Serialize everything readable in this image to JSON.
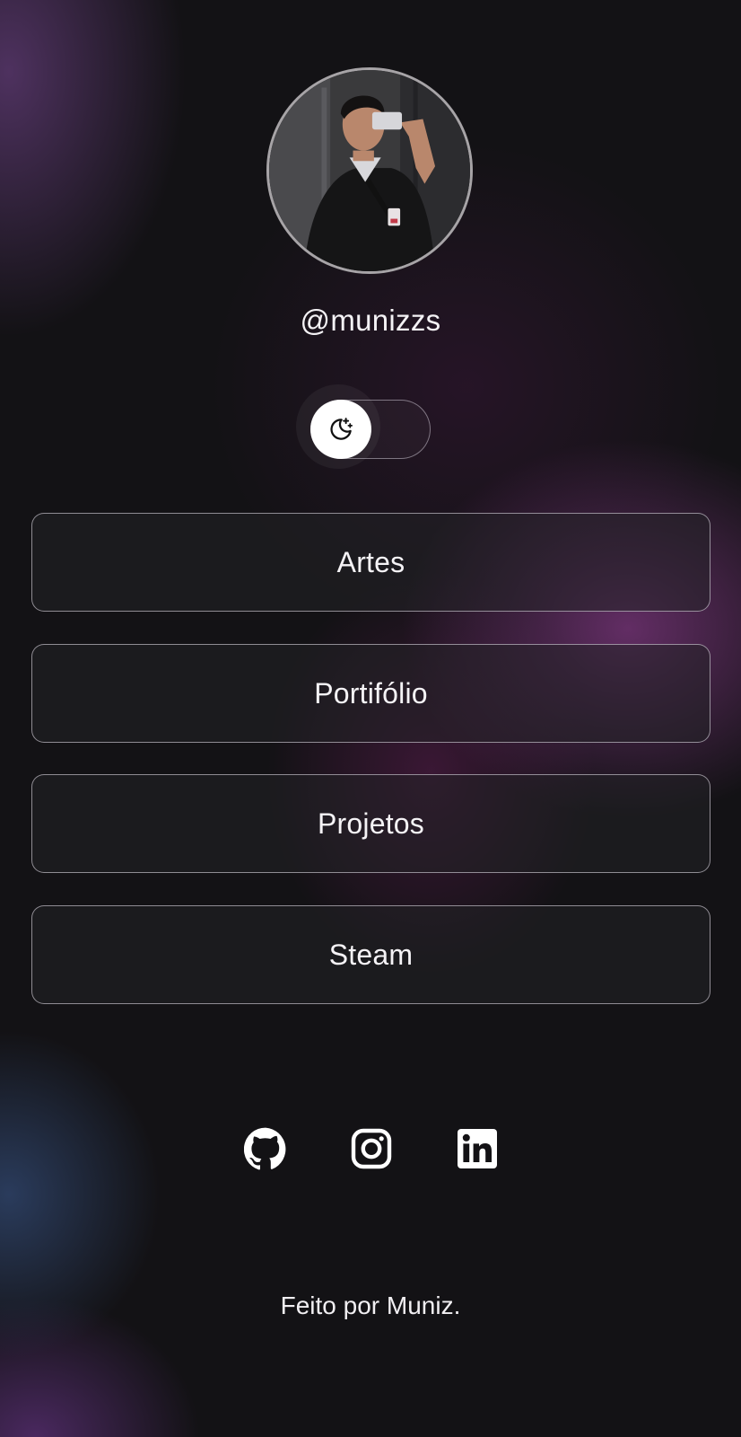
{
  "profile": {
    "handle": "@munizzs",
    "avatar_icon": "profile-photo"
  },
  "theme_toggle": {
    "icon": "moon-stars-icon",
    "state": "dark"
  },
  "links": [
    {
      "label": "Artes"
    },
    {
      "label": "Portifólio"
    },
    {
      "label": "Projetos"
    },
    {
      "label": "Steam"
    }
  ],
  "social": [
    {
      "name": "GitHub",
      "icon": "github-icon"
    },
    {
      "name": "Instagram",
      "icon": "instagram-icon"
    },
    {
      "name": "LinkedIn",
      "icon": "linkedin-icon"
    }
  ],
  "footer": {
    "text": "Feito por Muniz."
  },
  "colors": {
    "background": "#131215",
    "accent_purple": "#76347a",
    "accent_blue": "#30466e",
    "text": "#ffffff",
    "button_border": "#d7d2dc"
  }
}
